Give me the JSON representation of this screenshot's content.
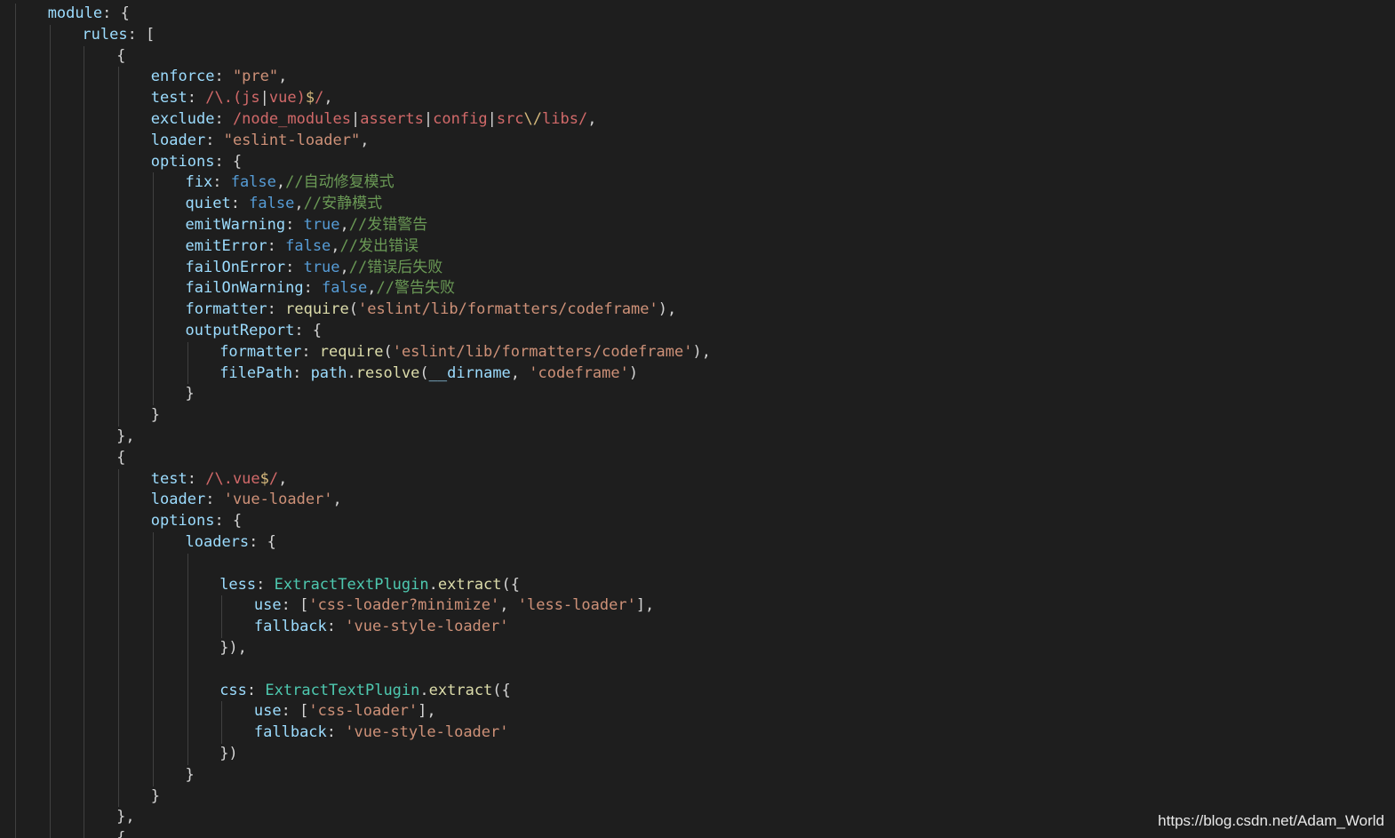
{
  "editor": {
    "theme_colors": {
      "background": "#1e1e1e",
      "key": "#9cdcfe",
      "string": "#ce9178",
      "regex": "#d16969",
      "boolean": "#569cd6",
      "comment": "#6a9955",
      "class": "#4ec9b0",
      "function": "#dcdcaa"
    },
    "lines": [
      {
        "indent": 1,
        "tokens": [
          {
            "t": "module",
            "c": "key"
          },
          {
            "t": ": {",
            "c": "punct"
          }
        ]
      },
      {
        "indent": 2,
        "tokens": [
          {
            "t": "rules",
            "c": "key"
          },
          {
            "t": ": [",
            "c": "punct"
          }
        ]
      },
      {
        "indent": 3,
        "tokens": [
          {
            "t": "{",
            "c": "punct"
          }
        ]
      },
      {
        "indent": 4,
        "tokens": [
          {
            "t": "enforce",
            "c": "key"
          },
          {
            "t": ": ",
            "c": "punct"
          },
          {
            "t": "\"pre\"",
            "c": "str"
          },
          {
            "t": ",",
            "c": "punct"
          }
        ]
      },
      {
        "indent": 4,
        "tokens": [
          {
            "t": "test",
            "c": "key"
          },
          {
            "t": ": ",
            "c": "punct"
          },
          {
            "t": "/\\.(js",
            "c": "regex"
          },
          {
            "t": "|",
            "c": "punct"
          },
          {
            "t": "vue)",
            "c": "regex"
          },
          {
            "t": "$",
            "c": "esc"
          },
          {
            "t": "/",
            "c": "regex"
          },
          {
            "t": ",",
            "c": "punct"
          }
        ]
      },
      {
        "indent": 4,
        "tokens": [
          {
            "t": "exclude",
            "c": "key"
          },
          {
            "t": ": ",
            "c": "punct"
          },
          {
            "t": "/node_modules",
            "c": "regex"
          },
          {
            "t": "|",
            "c": "punct"
          },
          {
            "t": "asserts",
            "c": "regex"
          },
          {
            "t": "|",
            "c": "punct"
          },
          {
            "t": "config",
            "c": "regex"
          },
          {
            "t": "|",
            "c": "punct"
          },
          {
            "t": "src",
            "c": "regex"
          },
          {
            "t": "\\/",
            "c": "esc"
          },
          {
            "t": "libs/",
            "c": "regex"
          },
          {
            "t": ",",
            "c": "punct"
          }
        ]
      },
      {
        "indent": 4,
        "tokens": [
          {
            "t": "loader",
            "c": "key"
          },
          {
            "t": ": ",
            "c": "punct"
          },
          {
            "t": "\"eslint-loader\"",
            "c": "str"
          },
          {
            "t": ",",
            "c": "punct"
          }
        ]
      },
      {
        "indent": 4,
        "tokens": [
          {
            "t": "options",
            "c": "key"
          },
          {
            "t": ": {",
            "c": "punct"
          }
        ]
      },
      {
        "indent": 5,
        "tokens": [
          {
            "t": "fix",
            "c": "key"
          },
          {
            "t": ": ",
            "c": "punct"
          },
          {
            "t": "false",
            "c": "bool"
          },
          {
            "t": ",",
            "c": "punct"
          },
          {
            "t": "//自动修复模式",
            "c": "comment"
          }
        ]
      },
      {
        "indent": 5,
        "tokens": [
          {
            "t": "quiet",
            "c": "key"
          },
          {
            "t": ": ",
            "c": "punct"
          },
          {
            "t": "false",
            "c": "bool"
          },
          {
            "t": ",",
            "c": "punct"
          },
          {
            "t": "//安静模式",
            "c": "comment"
          }
        ]
      },
      {
        "indent": 5,
        "tokens": [
          {
            "t": "emitWarning",
            "c": "key"
          },
          {
            "t": ": ",
            "c": "punct"
          },
          {
            "t": "true",
            "c": "bool"
          },
          {
            "t": ",",
            "c": "punct"
          },
          {
            "t": "//发错警告",
            "c": "comment"
          }
        ]
      },
      {
        "indent": 5,
        "tokens": [
          {
            "t": "emitError",
            "c": "key"
          },
          {
            "t": ": ",
            "c": "punct"
          },
          {
            "t": "false",
            "c": "bool"
          },
          {
            "t": ",",
            "c": "punct"
          },
          {
            "t": "//发出错误",
            "c": "comment"
          }
        ]
      },
      {
        "indent": 5,
        "tokens": [
          {
            "t": "failOnError",
            "c": "key"
          },
          {
            "t": ": ",
            "c": "punct"
          },
          {
            "t": "true",
            "c": "bool"
          },
          {
            "t": ",",
            "c": "punct"
          },
          {
            "t": "//错误后失败",
            "c": "comment"
          }
        ]
      },
      {
        "indent": 5,
        "tokens": [
          {
            "t": "failOnWarning",
            "c": "key"
          },
          {
            "t": ": ",
            "c": "punct"
          },
          {
            "t": "false",
            "c": "bool"
          },
          {
            "t": ",",
            "c": "punct"
          },
          {
            "t": "//警告失败",
            "c": "comment"
          }
        ]
      },
      {
        "indent": 5,
        "tokens": [
          {
            "t": "formatter",
            "c": "key"
          },
          {
            "t": ": ",
            "c": "punct"
          },
          {
            "t": "require",
            "c": "fn"
          },
          {
            "t": "(",
            "c": "punct"
          },
          {
            "t": "'eslint/lib/formatters/codeframe'",
            "c": "str"
          },
          {
            "t": "),",
            "c": "punct"
          }
        ]
      },
      {
        "indent": 5,
        "tokens": [
          {
            "t": "outputReport",
            "c": "key"
          },
          {
            "t": ": {",
            "c": "punct"
          }
        ]
      },
      {
        "indent": 6,
        "tokens": [
          {
            "t": "formatter",
            "c": "key"
          },
          {
            "t": ": ",
            "c": "punct"
          },
          {
            "t": "require",
            "c": "fn"
          },
          {
            "t": "(",
            "c": "punct"
          },
          {
            "t": "'eslint/lib/formatters/codeframe'",
            "c": "str"
          },
          {
            "t": "),",
            "c": "punct"
          }
        ]
      },
      {
        "indent": 6,
        "tokens": [
          {
            "t": "filePath",
            "c": "key"
          },
          {
            "t": ": ",
            "c": "punct"
          },
          {
            "t": "path",
            "c": "var"
          },
          {
            "t": ".",
            "c": "punct"
          },
          {
            "t": "resolve",
            "c": "fn"
          },
          {
            "t": "(",
            "c": "punct"
          },
          {
            "t": "__dirname",
            "c": "var"
          },
          {
            "t": ", ",
            "c": "punct"
          },
          {
            "t": "'codeframe'",
            "c": "str"
          },
          {
            "t": ")",
            "c": "punct"
          }
        ]
      },
      {
        "indent": 5,
        "tokens": [
          {
            "t": "}",
            "c": "punct"
          }
        ]
      },
      {
        "indent": 4,
        "tokens": [
          {
            "t": "}",
            "c": "punct"
          }
        ]
      },
      {
        "indent": 3,
        "tokens": [
          {
            "t": "},",
            "c": "punct"
          }
        ]
      },
      {
        "indent": 3,
        "tokens": [
          {
            "t": "{",
            "c": "punct"
          }
        ]
      },
      {
        "indent": 4,
        "tokens": [
          {
            "t": "test",
            "c": "key"
          },
          {
            "t": ": ",
            "c": "punct"
          },
          {
            "t": "/\\.vue",
            "c": "regex"
          },
          {
            "t": "$",
            "c": "esc"
          },
          {
            "t": "/",
            "c": "regex"
          },
          {
            "t": ",",
            "c": "punct"
          }
        ]
      },
      {
        "indent": 4,
        "tokens": [
          {
            "t": "loader",
            "c": "key"
          },
          {
            "t": ": ",
            "c": "punct"
          },
          {
            "t": "'vue-loader'",
            "c": "str"
          },
          {
            "t": ",",
            "c": "punct"
          }
        ]
      },
      {
        "indent": 4,
        "tokens": [
          {
            "t": "options",
            "c": "key"
          },
          {
            "t": ": {",
            "c": "punct"
          }
        ]
      },
      {
        "indent": 5,
        "tokens": [
          {
            "t": "loaders",
            "c": "key"
          },
          {
            "t": ": {",
            "c": "punct"
          }
        ]
      },
      {
        "indent": 6,
        "tokens": []
      },
      {
        "indent": 6,
        "tokens": [
          {
            "t": "less",
            "c": "key"
          },
          {
            "t": ": ",
            "c": "punct"
          },
          {
            "t": "ExtractTextPlugin",
            "c": "class"
          },
          {
            "t": ".",
            "c": "punct"
          },
          {
            "t": "extract",
            "c": "fn"
          },
          {
            "t": "({",
            "c": "punct"
          }
        ]
      },
      {
        "indent": 7,
        "tokens": [
          {
            "t": "use",
            "c": "key"
          },
          {
            "t": ": [",
            "c": "punct"
          },
          {
            "t": "'css-loader?minimize'",
            "c": "str"
          },
          {
            "t": ", ",
            "c": "punct"
          },
          {
            "t": "'less-loader'",
            "c": "str"
          },
          {
            "t": "],",
            "c": "punct"
          }
        ]
      },
      {
        "indent": 7,
        "tokens": [
          {
            "t": "fallback",
            "c": "key"
          },
          {
            "t": ": ",
            "c": "punct"
          },
          {
            "t": "'vue-style-loader'",
            "c": "str"
          }
        ]
      },
      {
        "indent": 6,
        "tokens": [
          {
            "t": "}),",
            "c": "punct"
          }
        ]
      },
      {
        "indent": 6,
        "tokens": []
      },
      {
        "indent": 6,
        "tokens": [
          {
            "t": "css",
            "c": "key"
          },
          {
            "t": ": ",
            "c": "punct"
          },
          {
            "t": "ExtractTextPlugin",
            "c": "class"
          },
          {
            "t": ".",
            "c": "punct"
          },
          {
            "t": "extract",
            "c": "fn"
          },
          {
            "t": "({",
            "c": "punct"
          }
        ]
      },
      {
        "indent": 7,
        "tokens": [
          {
            "t": "use",
            "c": "key"
          },
          {
            "t": ": [",
            "c": "punct"
          },
          {
            "t": "'css-loader'",
            "c": "str"
          },
          {
            "t": "],",
            "c": "punct"
          }
        ]
      },
      {
        "indent": 7,
        "tokens": [
          {
            "t": "fallback",
            "c": "key"
          },
          {
            "t": ": ",
            "c": "punct"
          },
          {
            "t": "'vue-style-loader'",
            "c": "str"
          }
        ]
      },
      {
        "indent": 6,
        "tokens": [
          {
            "t": "})",
            "c": "punct"
          }
        ]
      },
      {
        "indent": 5,
        "tokens": [
          {
            "t": "}",
            "c": "punct"
          }
        ]
      },
      {
        "indent": 4,
        "tokens": [
          {
            "t": "}",
            "c": "punct"
          }
        ]
      },
      {
        "indent": 3,
        "tokens": [
          {
            "t": "},",
            "c": "punct"
          }
        ]
      },
      {
        "indent": 3,
        "tokens": [
          {
            "t": "{",
            "c": "punct"
          }
        ]
      }
    ]
  },
  "watermark": {
    "text": "https://blog.csdn.net/Adam_World"
  }
}
